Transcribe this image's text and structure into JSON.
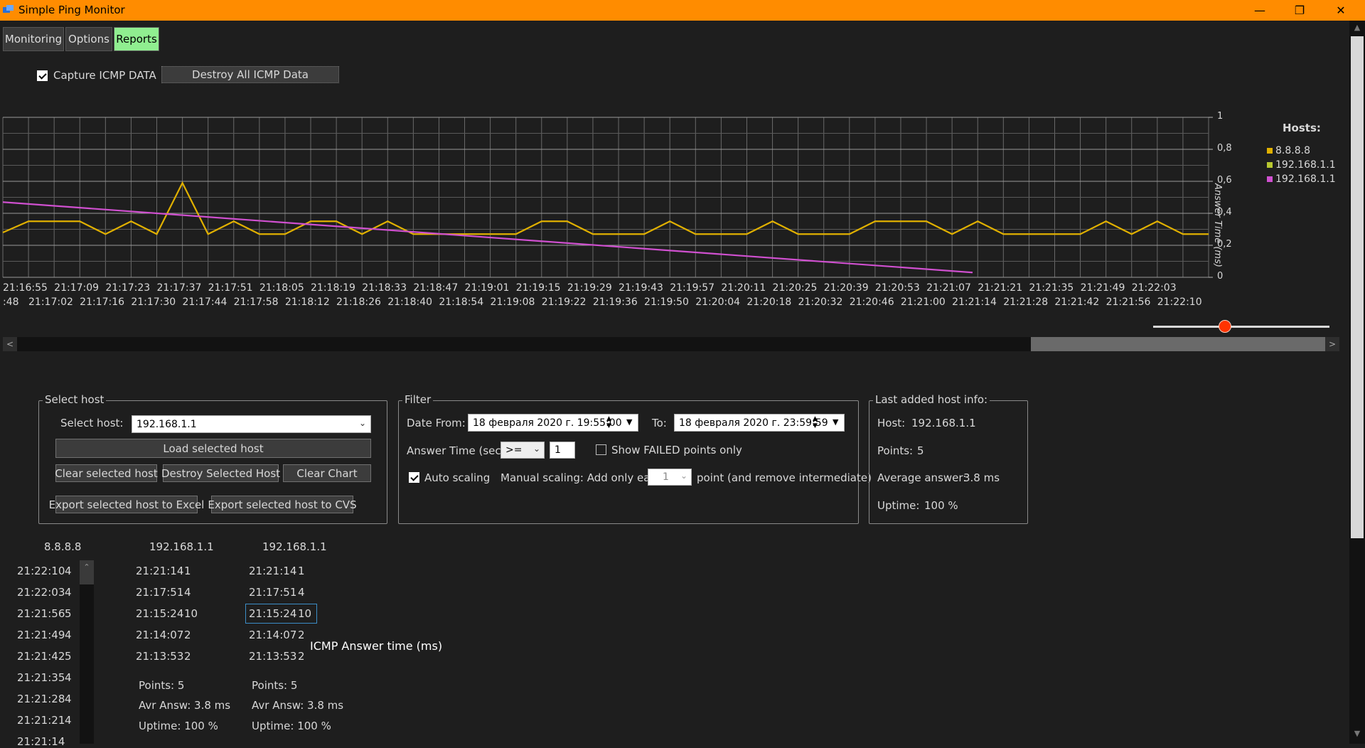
{
  "window": {
    "title": "Simple Ping Monitor",
    "minimize": "—",
    "maximize": "❐",
    "close": "✕"
  },
  "tabs": [
    {
      "label": "Monitoring",
      "active": false
    },
    {
      "label": "Options",
      "active": false
    },
    {
      "label": "Reports",
      "active": true
    }
  ],
  "capture": {
    "label": "Capture ICMP DATA",
    "checked": true,
    "destroy_button": "Destroy All ICMP Data"
  },
  "chart_data": {
    "type": "line",
    "ylabel": "Answer Time (ms)",
    "ylim": [
      0,
      1
    ],
    "y_ticks": [
      "0",
      "0,2",
      "0,4",
      "0,6",
      "0,8",
      "1"
    ],
    "x_ticks_upper": [
      "21:16:55",
      "21:17:09",
      "21:17:23",
      "21:17:37",
      "21:17:51",
      "21:18:05",
      "21:18:19",
      "21:18:33",
      "21:18:47",
      "21:19:01",
      "21:19:15",
      "21:19:29",
      "21:19:43",
      "21:19:57",
      "21:20:11",
      "21:20:25",
      "21:20:39",
      "21:20:53",
      "21:21:07",
      "21:21:21",
      "21:21:35",
      "21:21:49",
      "21:22:03"
    ],
    "x_ticks_lower": [
      ":48",
      "21:17:02",
      "21:17:16",
      "21:17:30",
      "21:17:44",
      "21:17:58",
      "21:18:12",
      "21:18:26",
      "21:18:40",
      "21:18:54",
      "21:19:08",
      "21:19:22",
      "21:19:36",
      "21:19:50",
      "21:20:04",
      "21:20:18",
      "21:20:32",
      "21:20:46",
      "21:21:00",
      "21:21:14",
      "21:21:28",
      "21:21:42",
      "21:21:56",
      "21:22:10"
    ],
    "legend_title": "Hosts:",
    "legend": [
      {
        "name": "8.8.8.8",
        "color": "#e0b000"
      },
      {
        "name": "192.168.1.1",
        "color": "#b8c830"
      },
      {
        "name": "192.168.1.1",
        "color": "#d050d0"
      }
    ],
    "series": [
      {
        "name": "8.8.8.8",
        "color": "#e0b000",
        "values": [
          0.28,
          0.35,
          0.35,
          0.35,
          0.27,
          0.35,
          0.27,
          0.59,
          0.27,
          0.35,
          0.27,
          0.27,
          0.35,
          0.35,
          0.27,
          0.35,
          0.27,
          0.27,
          0.27,
          0.27,
          0.27,
          0.35,
          0.35,
          0.27,
          0.27,
          0.27,
          0.35,
          0.27,
          0.27,
          0.27,
          0.35,
          0.27,
          0.27,
          0.27,
          0.35,
          0.35,
          0.35,
          0.27,
          0.35,
          0.27,
          0.27,
          0.27,
          0.27,
          0.35,
          0.27,
          0.35,
          0.27,
          0.27
        ]
      },
      {
        "name": "192.168.1.1",
        "color": "#d050d0",
        "values": [
          0.47,
          0.03
        ]
      }
    ]
  },
  "scrollbar": {
    "left_arrow": "<",
    "right_arrow": ">"
  },
  "select_host": {
    "title": "Select host",
    "label": "Select host:",
    "value": "192.168.1.1",
    "load_button": "Load selected host",
    "clear_button": "Clear selected host",
    "destroy_button": "Destroy Selected Host",
    "clear_chart_button": "Clear Chart",
    "export_excel_button": "Export selected host to Excel",
    "export_cvs_button": "Export selected host to CVS"
  },
  "filter": {
    "title": "Filter",
    "date_from_label": "Date From:",
    "date_from": "18 февраля 2020 г. 19:55:00",
    "to_label": "To:",
    "date_to": "18 февраля 2020 г. 23:59:59",
    "answer_time_label": "Answer Time (sec)",
    "operator": ">=",
    "answer_time_value": "1",
    "failed_label": "Show FAILED points only",
    "auto_scaling_label": "Auto scaling",
    "manual_label": "Manual scaling: Add only each",
    "manual_value": "1",
    "manual_suffix": "point (and remove intermediate)"
  },
  "last_host": {
    "title": "Last added host info:",
    "host_label": "Host:",
    "host": "192.168.1.1",
    "points_label": "Points:",
    "points": "5",
    "avg_label": "Average answer:",
    "avg": "3.8 ms",
    "uptime_label": "Uptime:",
    "uptime": "100 %"
  },
  "tables": [
    {
      "header": "8.8.8.8",
      "rows": [
        [
          "21:22:10",
          "4"
        ],
        [
          "21:22:03",
          "4"
        ],
        [
          "21:21:56",
          "5"
        ],
        [
          "21:21:49",
          "4"
        ],
        [
          "21:21:42",
          "5"
        ],
        [
          "21:21:35",
          "4"
        ],
        [
          "21:21:28",
          "4"
        ],
        [
          "21:21:21",
          "4"
        ],
        [
          "21:21:14",
          ""
        ]
      ]
    },
    {
      "header": "192.168.1.1",
      "rows": [
        [
          "21:21:14",
          "1"
        ],
        [
          "21:17:51",
          "4"
        ],
        [
          "21:15:24",
          "10"
        ],
        [
          "21:14:07",
          "2"
        ],
        [
          "21:13:53",
          "2"
        ]
      ],
      "points": "Points: 5",
      "avr": "Avr Answ: 3.8  ms",
      "uptime": "Uptime: 100 %"
    },
    {
      "header": "192.168.1.1",
      "rows": [
        [
          "21:21:14",
          "1"
        ],
        [
          "21:17:51",
          "4"
        ],
        [
          "21:15:24",
          "10"
        ],
        [
          "21:14:07",
          "2"
        ],
        [
          "21:13:53",
          "2"
        ]
      ],
      "points": "Points: 5",
      "avr": "Avr Answ: 3.8  ms",
      "uptime": "Uptime: 100 %"
    }
  ],
  "tooltip": "ICMP Answer time (ms)"
}
